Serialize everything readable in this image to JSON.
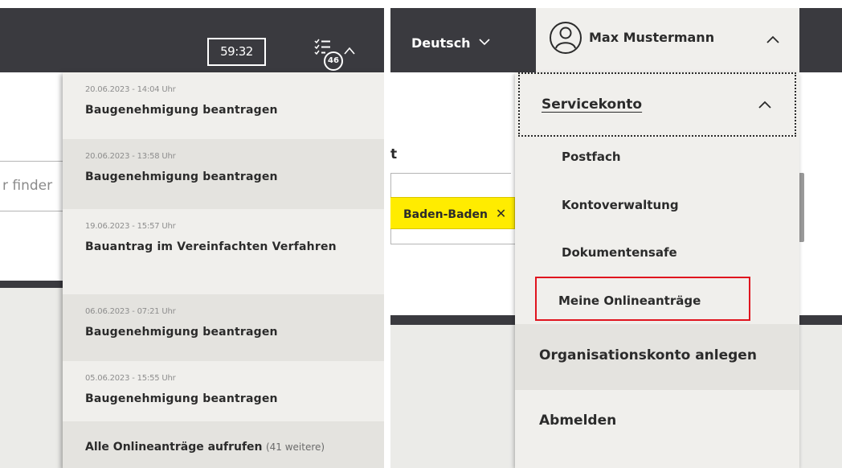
{
  "left": {
    "timer": "59:32",
    "queue_badge": "46",
    "search_fragment": "r finder",
    "entries": [
      {
        "date": "20.06.2023 - 14:04 Uhr",
        "title": "Baugenehmigung beantragen"
      },
      {
        "date": "20.06.2023 - 13:58 Uhr",
        "title": "Baugenehmigung beantragen"
      },
      {
        "date": "19.06.2023 - 15:57 Uhr",
        "title": "Bauantrag im Vereinfachten Verfahren"
      },
      {
        "date": "06.06.2023 - 07:21 Uhr",
        "title": "Baugenehmigung beantragen"
      },
      {
        "date": "05.06.2023 - 15:55 Uhr",
        "title": "Baugenehmigung beantragen"
      }
    ],
    "footer_link": "Alle Onlineanträge aufrufen",
    "footer_count": "(41 weitere)"
  },
  "right": {
    "language": "Deutsch",
    "user_name": "Max Mustermann",
    "search_fragment": "t",
    "region_chip": "Baden-Baden",
    "region_chip_close": "✕",
    "menu": {
      "servicekonto": "Servicekonto",
      "items": [
        "Postfach",
        "Kontoverwaltung",
        "Dokumentensafe",
        "Meine Onlineanträge"
      ],
      "organisation": "Organisationskonto anlegen",
      "logout": "Abmelden"
    },
    "highlight_color": "#e0141e"
  },
  "colors": {
    "header_bg": "#3a3a3f",
    "dropdown_bg": "#f0efec",
    "dropdown_alt_bg": "#e4e3df",
    "chip_yellow": "#ffec00"
  },
  "icons": {
    "queue": "task-list-icon",
    "user": "user-avatar-icon",
    "chevron_up": "chevron-up-icon",
    "chevron_down": "chevron-down-icon",
    "close": "close-icon"
  }
}
